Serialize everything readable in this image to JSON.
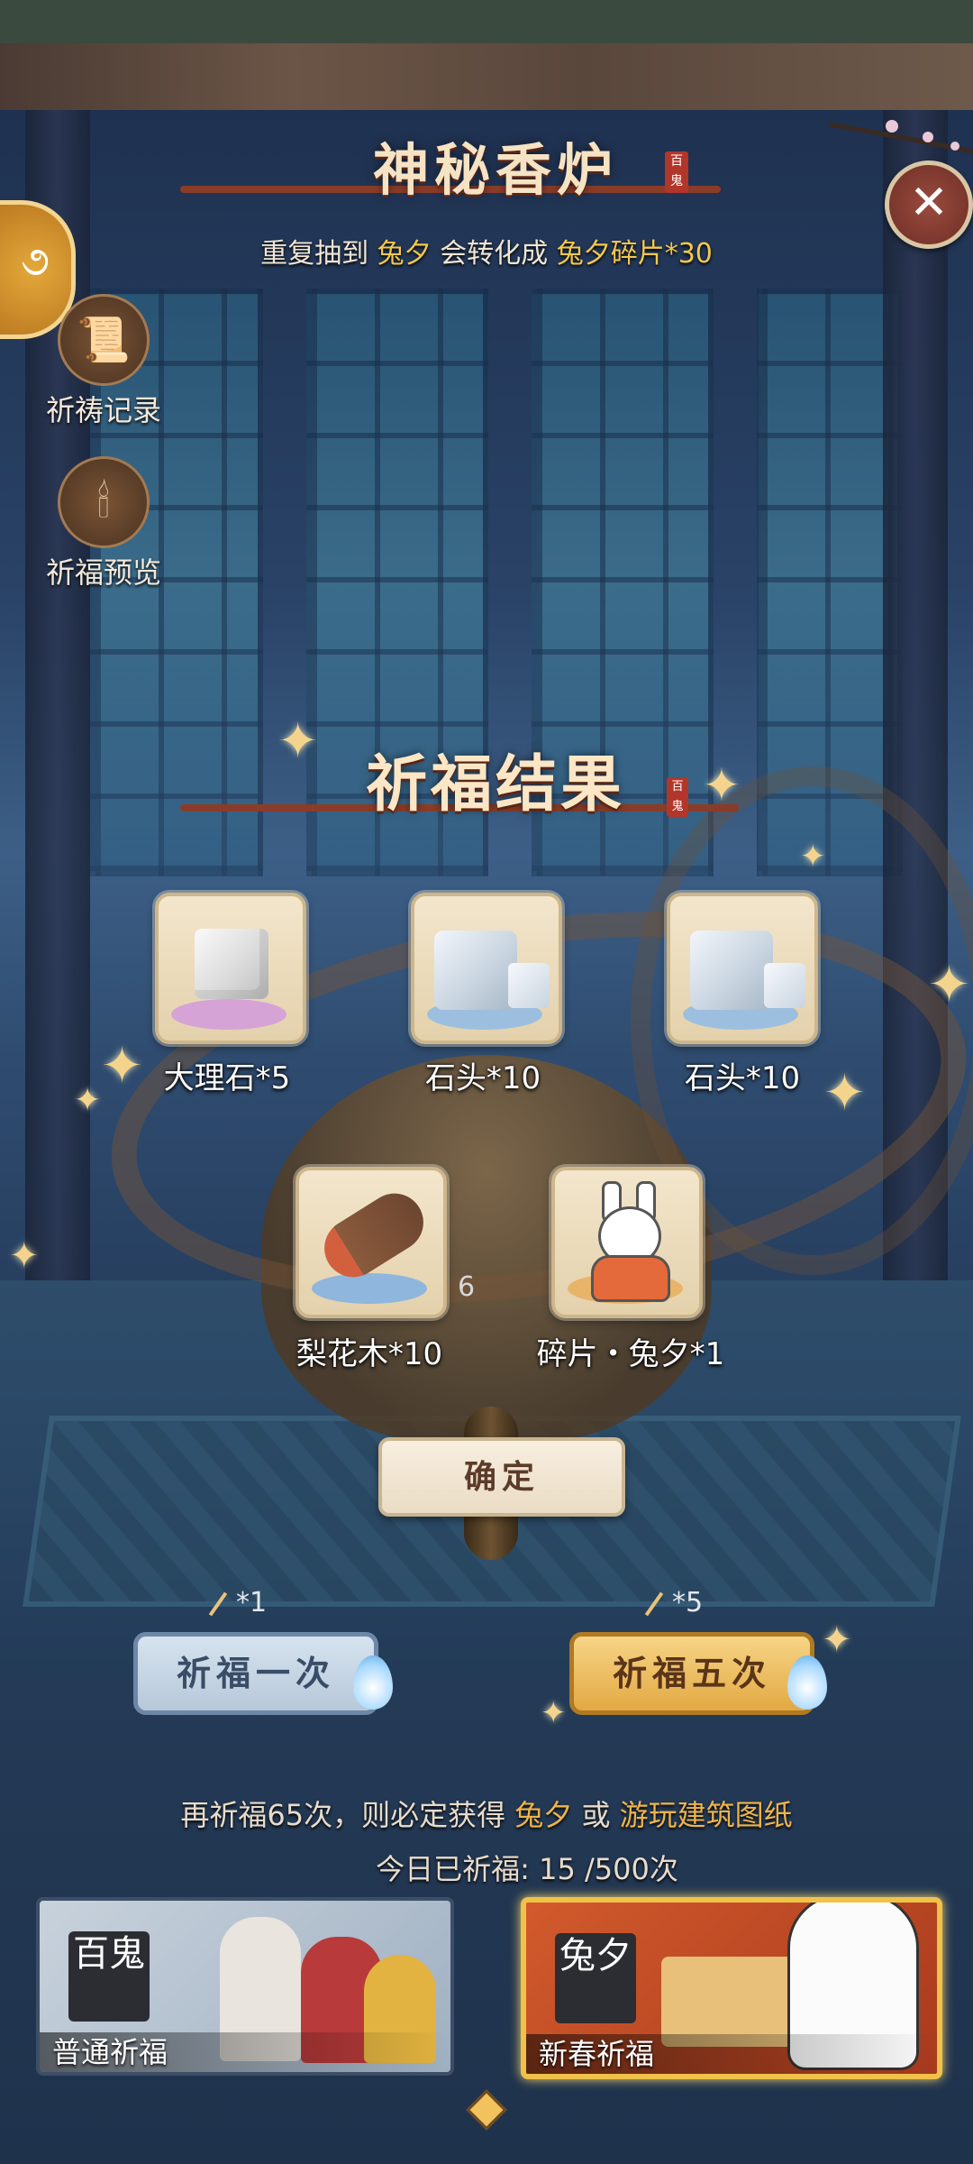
{
  "header": {
    "title": "神秘香炉",
    "seal_text": "百鬼",
    "notice_prefix": "重复抽到",
    "notice_name": "兔夕",
    "notice_middle": "会转化成",
    "notice_reward": "兔夕碎片*30",
    "close_glyph": "✕"
  },
  "sidebar": {
    "history_label": "祈祷记录",
    "preview_label": "祈福预览"
  },
  "result": {
    "title": "祈福结果",
    "seal_text": "百鬼",
    "items": [
      {
        "label": "大理石*5",
        "icon": "marble-icon"
      },
      {
        "label": "石头*10",
        "icon": "stone-icon"
      },
      {
        "label": "石头*10",
        "icon": "stone-icon"
      },
      {
        "label": "梨花木*10",
        "icon": "pear-wood-icon"
      },
      {
        "label": "碎片・兔夕*1",
        "icon": "rabbit-fragment-icon"
      }
    ],
    "count_badge": "6",
    "confirm_label": "确定"
  },
  "pray": {
    "once_cost": "*1",
    "five_cost": "*5",
    "once_label": "祈福一次",
    "five_label": "祈福五次"
  },
  "guarantee": {
    "prefix": "再祈福65次，则必定获得",
    "reward1": "兔夕",
    "middle": "或",
    "reward2": "游玩建筑图纸"
  },
  "today": {
    "label": "今日已祈福:",
    "value": "15 /500次"
  },
  "pools": {
    "normal_label": "普通祈福",
    "normal_logo": "百鬼",
    "spring_label": "新春祈福",
    "spring_logo": "兔夕"
  },
  "colors": {
    "accent_gold": "#f5c84c",
    "title_red": "#8a3c28",
    "confirm_text": "#5c3b2a"
  }
}
